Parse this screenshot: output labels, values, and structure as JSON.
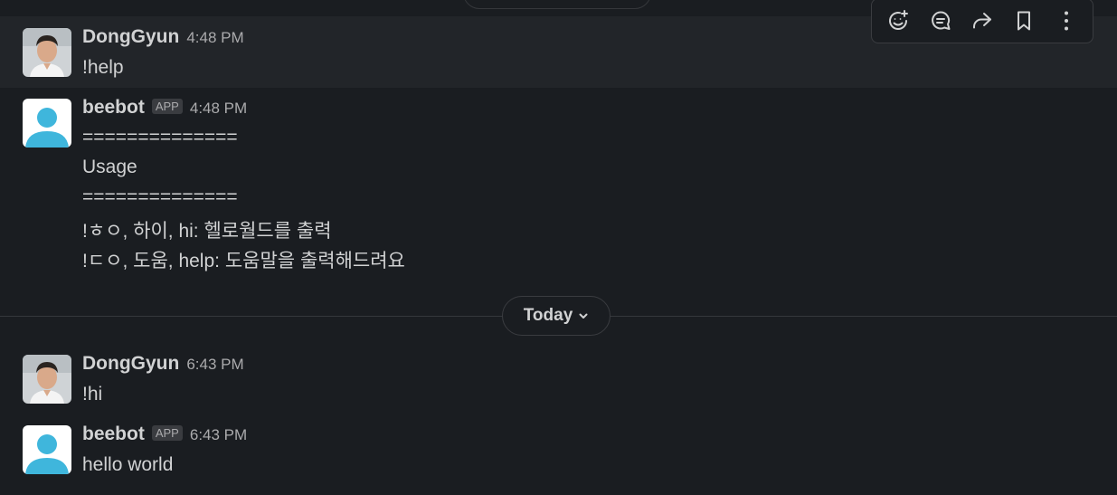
{
  "messages": [
    {
      "author": "DongGyun",
      "time": "4:48 PM",
      "lines": [
        "!help"
      ]
    },
    {
      "author": "beebot",
      "badge": "APP",
      "time": "4:48 PM",
      "lines": [
        "==============",
        "Usage",
        "==============",
        "!ㅎㅇ, 하이, hi: 헬로월드를 출력",
        "!ㄷㅇ, 도움, help: 도움말을 출력해드려요"
      ]
    },
    {
      "author": "DongGyun",
      "time": "6:43 PM",
      "lines": [
        "!hi"
      ]
    },
    {
      "author": "beebot",
      "badge": "APP",
      "time": "6:43 PM",
      "lines": [
        "hello world"
      ]
    }
  ],
  "date_divider": {
    "label": "Today",
    "icon": "chevron-down-icon"
  },
  "message_actions": [
    {
      "icon": "add-reaction-icon"
    },
    {
      "icon": "reply-thread-icon"
    },
    {
      "icon": "forward-icon"
    },
    {
      "icon": "bookmark-icon"
    },
    {
      "icon": "more-actions-icon"
    }
  ],
  "colors": {
    "background": "#1a1d21",
    "hover_row": "#222529",
    "text": "#d1d2d3",
    "muted": "#ababad",
    "bot_avatar": "#3fb6dc"
  }
}
